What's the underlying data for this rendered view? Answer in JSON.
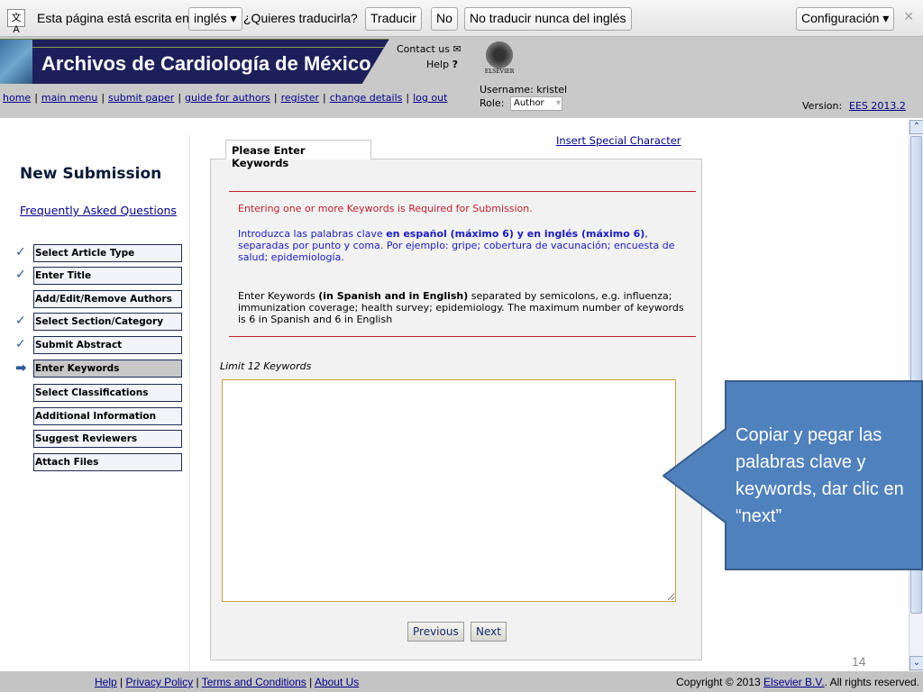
{
  "translate_bar": {
    "prefix": "Esta página está escrita en",
    "language": "inglés ▾",
    "question": "¿Quieres traducirla?",
    "translate": "Traducir",
    "no": "No",
    "never": "No traducir nunca del inglés",
    "settings": "Configuración ▾",
    "close": "×"
  },
  "header": {
    "journal_title": "Archivos de Cardiología de México",
    "contact": "Contact us",
    "help": "Help",
    "publisher": "ELSEVIER",
    "username": "Username: kristel",
    "role_label": "Role:",
    "role_value": "Author",
    "version_label": "Version:",
    "version": "EES 2013.2",
    "nav": [
      "home",
      "main menu",
      "submit paper",
      "guide for authors",
      "register",
      "change details",
      "log out"
    ]
  },
  "sidebar": {
    "title": "New Submission",
    "faq": "Frequently Asked Questions",
    "steps": [
      {
        "label": "Select Article Type",
        "status": "done"
      },
      {
        "label": "Enter Title",
        "status": "done"
      },
      {
        "label": "Add/Edit/Remove Authors",
        "status": ""
      },
      {
        "label": "Select Section/Category",
        "status": "done"
      },
      {
        "label": "Submit Abstract",
        "status": "done"
      },
      {
        "label": "Enter Keywords",
        "status": "current"
      },
      {
        "label": "Select Classifications",
        "status": ""
      },
      {
        "label": "Additional Information",
        "status": ""
      },
      {
        "label": "Suggest Reviewers",
        "status": ""
      },
      {
        "label": "Attach Files",
        "status": ""
      }
    ]
  },
  "main": {
    "tab": "Please Enter Keywords",
    "insert_special": "Insert Special Character",
    "required": "Entering one or more Keywords is Required for Submission.",
    "es_1": "Introduzca las palabras clave ",
    "es_bold": "en español (máximo 6) y en inglés (máximo 6)",
    "es_2": ", separadas por punto y coma. Por ejemplo: gripe; cobertura de vacunación; encuesta de salud; epidemiología.",
    "en_1": "Enter Keywords ",
    "en_bold": "(in Spanish and in English)",
    "en_2": " separated by semicolons, e.g. influenza; immunization coverage; health survey; epidemiology. The maximum number of keywords is 6 in Spanish and 6 in English",
    "limit": "Limit 12 Keywords",
    "keywords_value": "",
    "previous": "Previous",
    "next": "Next"
  },
  "callout": {
    "text": "Copiar y pegar las palabras clave y keywords, dar clic en “next”",
    "color": "#4f81bd"
  },
  "slide_number": "14",
  "footer": {
    "links": [
      "Help",
      "Privacy Policy",
      "Terms and Conditions",
      "About Us"
    ],
    "copyright_1": "Copyright © 2013 ",
    "copyright_link": "Elsevier B.V.",
    "copyright_2": ". All rights reserved."
  }
}
